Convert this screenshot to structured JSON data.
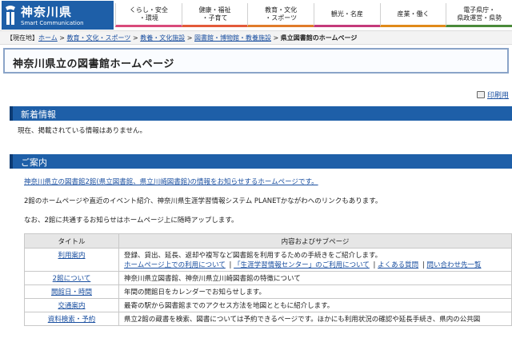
{
  "header": {
    "logo_title": "神奈川県",
    "logo_sub": "Smart Communication",
    "nav": [
      "くらし・安全\n・環境",
      "健康・福祉\n・子育て",
      "教育・文化\n・スポーツ",
      "観光・名産",
      "産業・働く",
      "電子県庁・\n県政運営・県勢"
    ]
  },
  "breadcrumb": {
    "label": "【現在地】",
    "links": [
      "ホーム",
      "教育・文化・スポーツ",
      "教養・文化施設",
      "図書館・博物館・教養施設"
    ],
    "sep": " > ",
    "current": "県立図書館のホームページ"
  },
  "page_title": "神奈川県立の図書館ホームページ",
  "print_label": "印刷用",
  "news": {
    "heading": "新着情報",
    "body": "現在、掲載されている情報はありません。"
  },
  "guide": {
    "heading": "ご案内",
    "line1": "神奈川県立の図書館2館(県立図書館、県立川崎図書館)の情報をお知らせするホームページです。",
    "line2": "2館のホームページや直近のイベント紹介、神奈川県生涯学習情報システム PLANETかながわへのリンクもあります。",
    "line3": "なお、2館に共通するお知らせはホームページ上に随時アップします。"
  },
  "table": {
    "headers": [
      "タイトル",
      "内容およびサブページ"
    ],
    "rows": [
      {
        "title": "利用案内",
        "desc": "登録、貸出、延長、返却や複写など図書館を利用するための手続きをご紹介します。",
        "links": [
          "ホームページ上での利用について",
          "「生涯学習情報センター」のご利用について",
          "よくある質問",
          "問い合わせ先一覧"
        ]
      },
      {
        "title": "2館について",
        "desc": "神奈川県立図書館、神奈川県立川崎図書館の特徴について",
        "links": []
      },
      {
        "title": "開館日・時間",
        "desc": "年間の開館日をカレンダーでお知らせします。",
        "links": []
      },
      {
        "title": "交通案内",
        "desc": "最寄の駅から図書館までのアクセス方法を地図とともに紹介します。",
        "links": []
      },
      {
        "title": "資料検索・予約",
        "desc": "県立2館の蔵書を検索、図書については予約できるページです。ほかにも利用状況の確認や延長手続き、県内の公共図",
        "links": []
      }
    ]
  }
}
